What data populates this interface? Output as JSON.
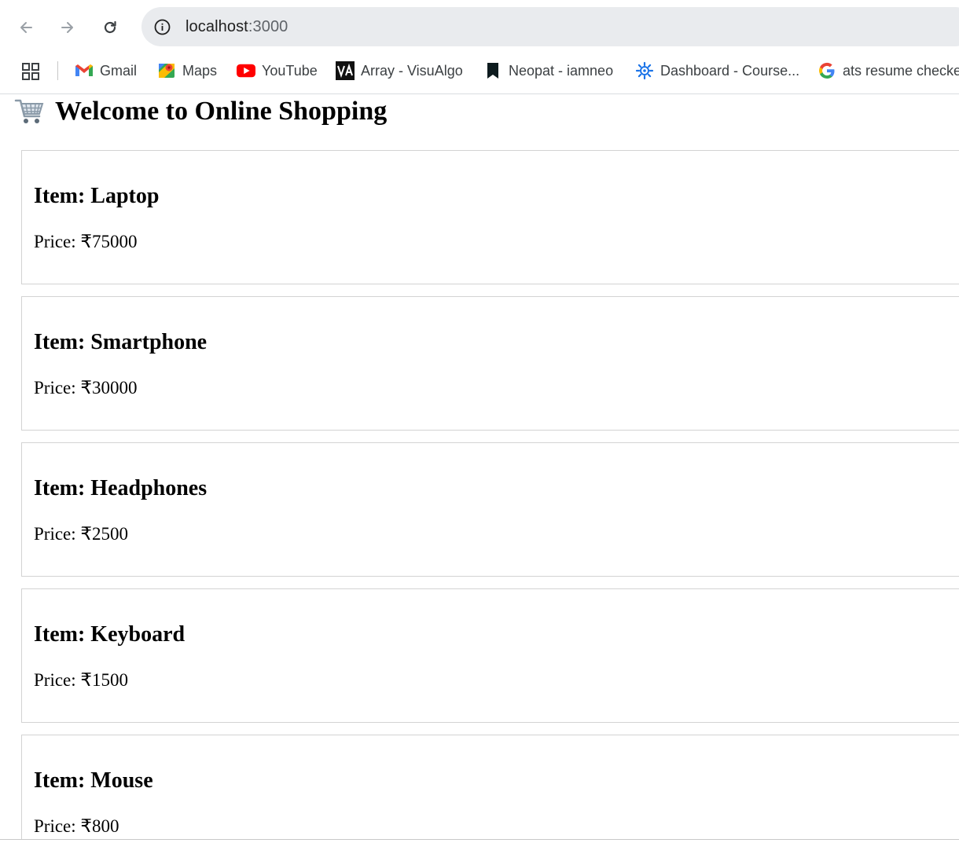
{
  "browser": {
    "url_host": "localhost",
    "url_port": ":3000",
    "bookmarks": [
      {
        "label": "Gmail",
        "icon": "gmail-icon"
      },
      {
        "label": "Maps",
        "icon": "maps-icon"
      },
      {
        "label": "YouTube",
        "icon": "youtube-icon"
      },
      {
        "label": "Array - VisuAlgo",
        "icon": "visualgo-icon"
      },
      {
        "label": "Neopat - iamneo",
        "icon": "neopat-icon"
      },
      {
        "label": "Dashboard - Course...",
        "icon": "dashboard-gear-icon"
      },
      {
        "label": "ats resume checker",
        "icon": "google-icon"
      }
    ]
  },
  "page": {
    "title": "Welcome to Online Shopping",
    "title_icon": "shopping-cart-emoji",
    "item_prefix": "Item: ",
    "price_prefix": "Price: ₹",
    "products": [
      {
        "name": "Laptop",
        "price": "75000"
      },
      {
        "name": "Smartphone",
        "price": "30000"
      },
      {
        "name": "Headphones",
        "price": "2500"
      },
      {
        "name": "Keyboard",
        "price": "1500"
      },
      {
        "name": "Mouse",
        "price": "800"
      }
    ]
  },
  "colors": {
    "omnibox_bg": "#e9ebee",
    "card_border": "#d3d3d3",
    "youtube_red": "#ff0000",
    "dashboard_blue": "#1a73e8"
  }
}
